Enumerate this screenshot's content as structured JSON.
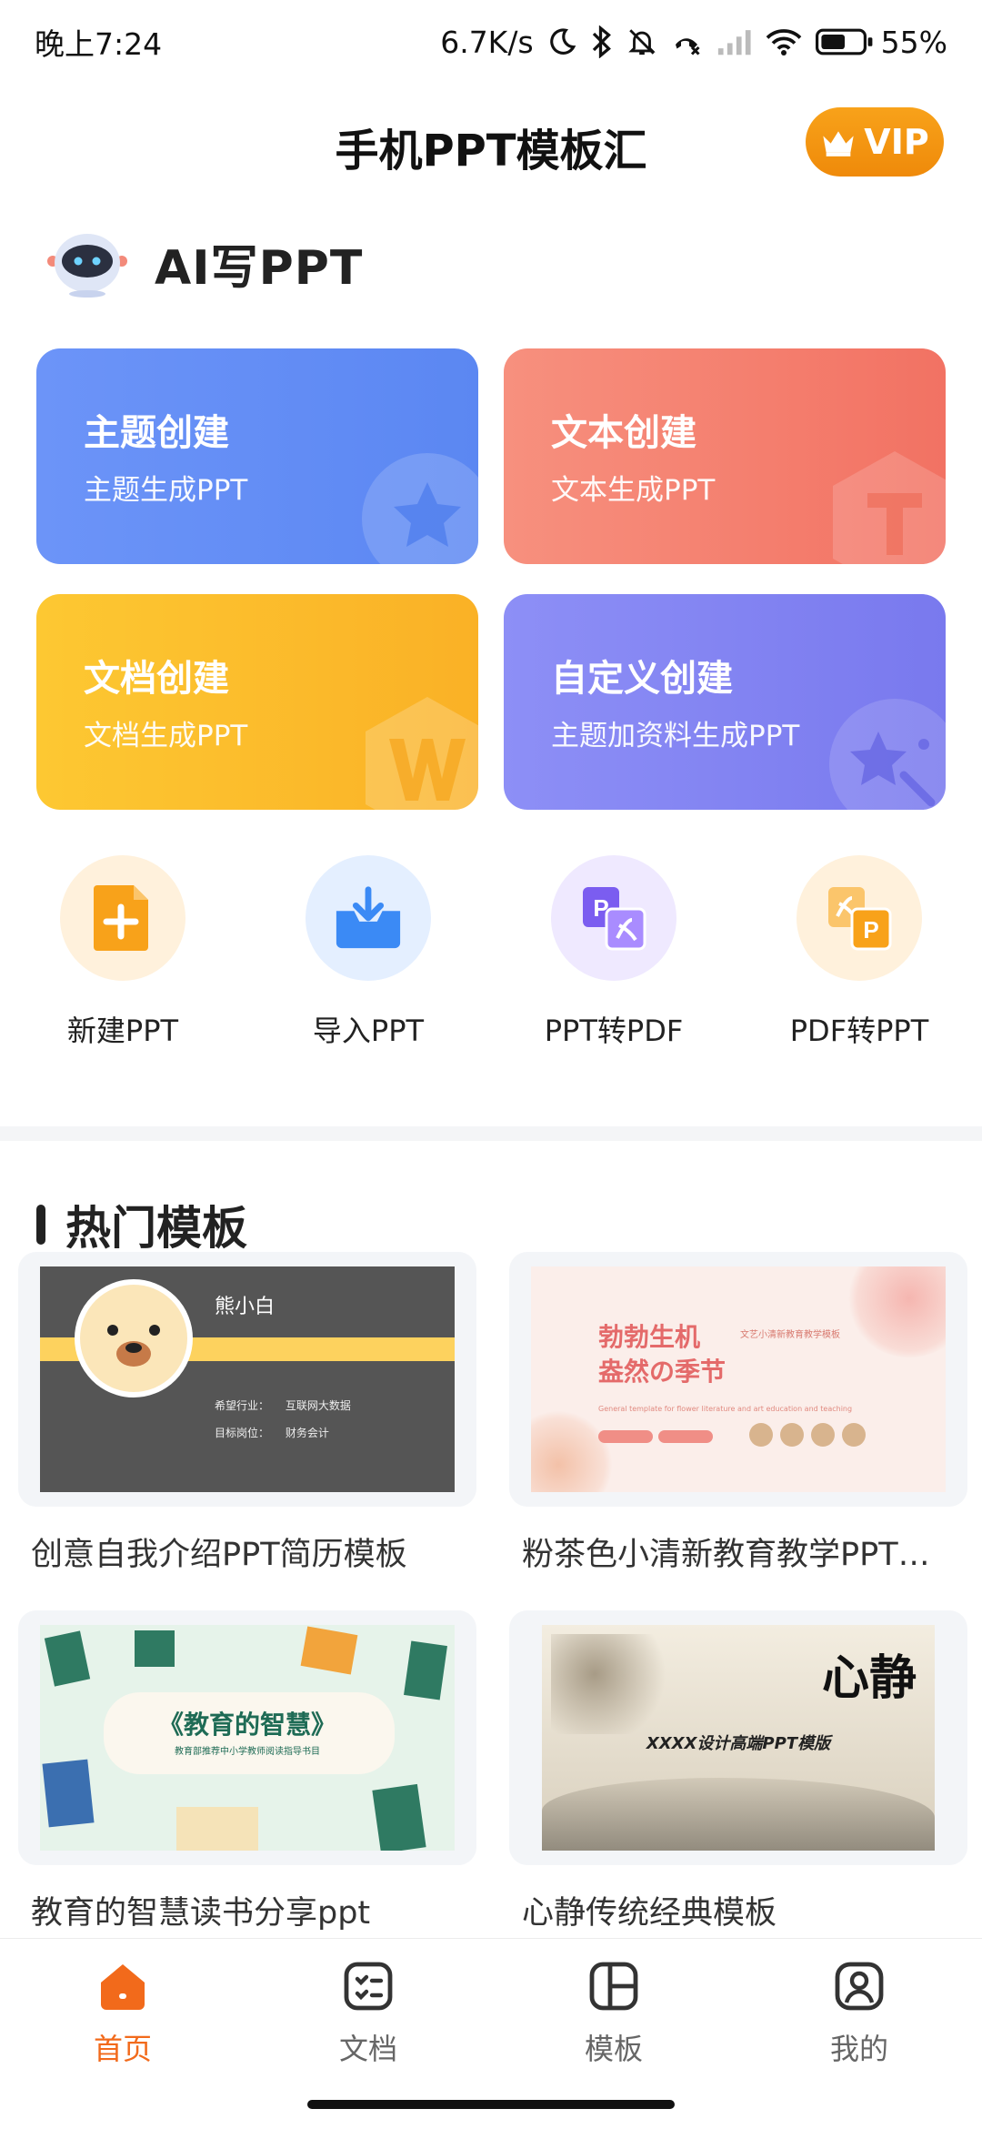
{
  "status_bar": {
    "time": "晚上7:24",
    "network_speed": "6.7K/s",
    "battery": "55%"
  },
  "header": {
    "title": "手机PPT模板汇",
    "vip_label": "VIP"
  },
  "ai_section": {
    "title": "AI写PPT",
    "cards": [
      {
        "title": "主题创建",
        "subtitle": "主题生成PPT",
        "icon": "star-icon"
      },
      {
        "title": "文本创建",
        "subtitle": "文本生成PPT",
        "icon": "text-t-icon"
      },
      {
        "title": "文档创建",
        "subtitle": "文档生成PPT",
        "icon": "word-w-icon"
      },
      {
        "title": "自定义创建",
        "subtitle": "主题加资料生成PPT",
        "icon": "magic-star-icon"
      }
    ]
  },
  "tools": [
    {
      "label": "新建PPT",
      "icon": "new-file-icon"
    },
    {
      "label": "导入PPT",
      "icon": "import-tray-icon"
    },
    {
      "label": "PPT转PDF",
      "icon": "ppt-to-pdf-icon"
    },
    {
      "label": "PDF转PPT",
      "icon": "pdf-to-ppt-icon"
    }
  ],
  "hot_templates": {
    "title": "热门模板",
    "items": [
      {
        "name": "创意自我介绍PPT简历模板",
        "thumb_text": {
          "name": "熊小白",
          "line1_label": "希望行业：",
          "line1_value": "互联网大数据",
          "line2_label": "目标岗位：",
          "line2_value": "财务会计"
        }
      },
      {
        "name": "粉茶色小清新教育教学PPT…",
        "thumb_text": {
          "title_line1": "勃勃生机",
          "title_line2": "盎然の季节",
          "subtitle": "文艺小清新教育教学模板",
          "english": "General template for flower literature and art education and teaching"
        }
      },
      {
        "name": "教育的智慧读书分享ppt",
        "thumb_text": {
          "title": "《教育的智慧》",
          "subtitle": "教育部推荐中小学教师阅读指导书目"
        }
      },
      {
        "name": "心静传统经典模板",
        "thumb_text": {
          "title": "心静",
          "subtitle": "XXXX设计高端PPT模版"
        }
      }
    ]
  },
  "bottom_nav": {
    "items": [
      {
        "label": "首页",
        "icon": "home-icon",
        "active": true
      },
      {
        "label": "文档",
        "icon": "document-list-icon",
        "active": false
      },
      {
        "label": "模板",
        "icon": "template-grid-icon",
        "active": false
      },
      {
        "label": "我的",
        "icon": "profile-icon",
        "active": false
      }
    ]
  },
  "colors": {
    "accent_orange": "#f26a1b",
    "vip_orange": "#f5961a",
    "card_blue": "#6c94f8",
    "card_coral": "#f58a78",
    "card_yellow": "#fcbf2e",
    "card_purple": "#8587f3"
  }
}
